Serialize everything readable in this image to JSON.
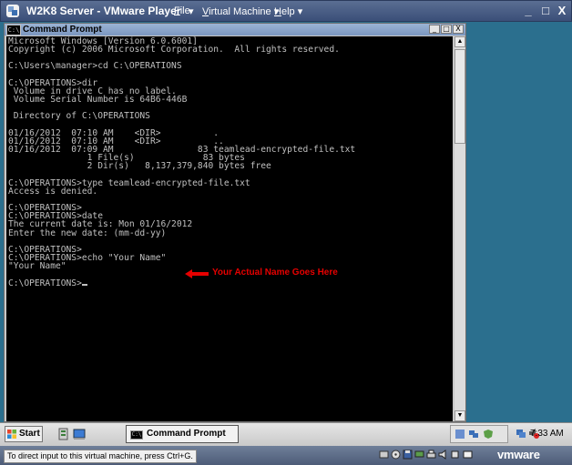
{
  "player": {
    "title": "W2K8 Server - VMware Player",
    "menus": [
      {
        "label": "File",
        "mnemonic": "F",
        "rest": "ile"
      },
      {
        "label": "Virtual Machine",
        "mnemonic": "V",
        "rest": "irtual Machine"
      },
      {
        "label": "Help",
        "mnemonic": "H",
        "rest": "elp"
      }
    ],
    "window_buttons": {
      "minimize": "_",
      "restore": "□",
      "close": "X"
    },
    "status_text": "To direct input to this virtual machine, press Ctrl+G.",
    "brand": "vmware",
    "device_icons": [
      "hard-disk-icon",
      "cd-drive-icon",
      "floppy-icon",
      "network-icon",
      "printer-icon",
      "sound-icon",
      "usb-icon",
      "message-icon"
    ]
  },
  "cmd_window": {
    "title": "Command Prompt",
    "icon_text": "C:\\",
    "buttons": {
      "minimize": "_",
      "maximize": "□",
      "close": "X"
    },
    "console_lines": [
      "Microsoft Windows [Version 6.0.6001]",
      "Copyright (c) 2006 Microsoft Corporation.  All rights reserved.",
      "",
      "C:\\Users\\manager>cd C:\\OPERATIONS",
      "",
      "C:\\OPERATIONS>dir",
      " Volume in drive C has no label.",
      " Volume Serial Number is 64B6-446B",
      "",
      " Directory of C:\\OPERATIONS",
      "",
      "01/16/2012  07:10 AM    <DIR>          .",
      "01/16/2012  07:10 AM    <DIR>          ..",
      "01/16/2012  07:09 AM                83 teamlead-encrypted-file.txt",
      "               1 File(s)             83 bytes",
      "               2 Dir(s)   8,137,379,840 bytes free",
      "",
      "C:\\OPERATIONS>type teamlead-encrypted-file.txt",
      "Access is denied.",
      "",
      "C:\\OPERATIONS>",
      "C:\\OPERATIONS>date",
      "The current date is: Mon 01/16/2012",
      "Enter the new date: (mm-dd-yy)",
      "",
      "C:\\OPERATIONS>",
      "C:\\OPERATIONS>echo \"Your Name\"",
      "\"Your Name\"",
      "",
      "C:\\OPERATIONS>"
    ],
    "annotation": "Your Actual Name Goes Here",
    "annotation_color": "#e60000",
    "scroll_up": "▲",
    "scroll_down": "▼"
  },
  "taskbar": {
    "start_label": "Start",
    "task_label": "Command Prompt",
    "clock": "7:33 AM",
    "quick_launch_icons": [
      "server-manager-icon",
      "show-desktop-icon"
    ]
  },
  "colors": {
    "desktop": "#2b6f8e",
    "console_bg": "#000000",
    "console_text": "#c0c0c0"
  }
}
